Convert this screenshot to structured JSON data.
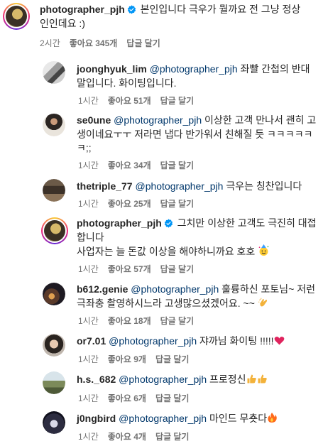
{
  "comments": [
    {
      "username": "photographer_pjh",
      "verified": true,
      "mention": "",
      "text": "본인입니다 극우가 뭘까요 전 그냥 정상인인데요 :)",
      "time": "2시간",
      "likes": "좋아요 345개",
      "reply": "답글 달기"
    },
    {
      "username": "joonghyuk_lim",
      "mention": "@photographer_pjh",
      "text": "좌빨 간첩의 반대말입니다. 화이팅입니다.",
      "time": "1시간",
      "likes": "좋아요 51개",
      "reply": "답글 달기"
    },
    {
      "username": "se0une",
      "mention": "@photographer_pjh",
      "text": "이상한 고객 만나서 괜히 고생이네요ㅜㅜ 저라면 냅다 반가워서 친해질 듯 ㅋㅋㅋㅋㅋㅋ;;",
      "time": "1시간",
      "likes": "좋아요 34개",
      "reply": "답글 달기"
    },
    {
      "username": "thetriple_77",
      "mention": "@photographer_pjh",
      "text": "극우는 칭찬입니다",
      "time": "1시간",
      "likes": "좋아요 25개",
      "reply": "답글 달기"
    },
    {
      "username": "photographer_pjh",
      "verified": true,
      "mention": "",
      "text": "그치만 이상한 고객도 극진히 대접합니다",
      "text2": "사업자는 늘 돈값 이상을 해야하니까요 호호",
      "emoji": "face-with-party-hat",
      "time": "1시간",
      "likes": "좋아요 57개",
      "reply": "답글 달기"
    },
    {
      "username": "b612.genie",
      "mention": "@photographer_pjh",
      "text": "훌륭하신 포토님~ 저런 극좌충 촬영하시느라 고생많으셨겠어요. ~~",
      "emoji": "clapping-hands",
      "time": "1시간",
      "likes": "좋아요 18개",
      "reply": "답글 달기"
    },
    {
      "username": "or7.01",
      "mention": "@photographer_pjh",
      "text": "쟈까님 화이팅 !!!!!",
      "emoji": "red-heart",
      "time": "1시간",
      "likes": "좋아요 9개",
      "reply": "답글 달기"
    },
    {
      "username": "h.s._682",
      "mention": "@photographer_pjh",
      "text": "프로정신",
      "emoji": "thumbs-up-x2",
      "time": "1시간",
      "likes": "좋아요 6개",
      "reply": "답글 달기"
    },
    {
      "username": "j0ngbird",
      "mention": "@photographer_pjh",
      "text": "마인드 무춋다",
      "emoji": "fire",
      "time": "1시간",
      "likes": "좋아요 4개",
      "reply": "답글 달기"
    }
  ],
  "colors": {
    "text": "#262626",
    "meta": "#737373",
    "mention": "#00376b",
    "verified": "#0095f6"
  }
}
